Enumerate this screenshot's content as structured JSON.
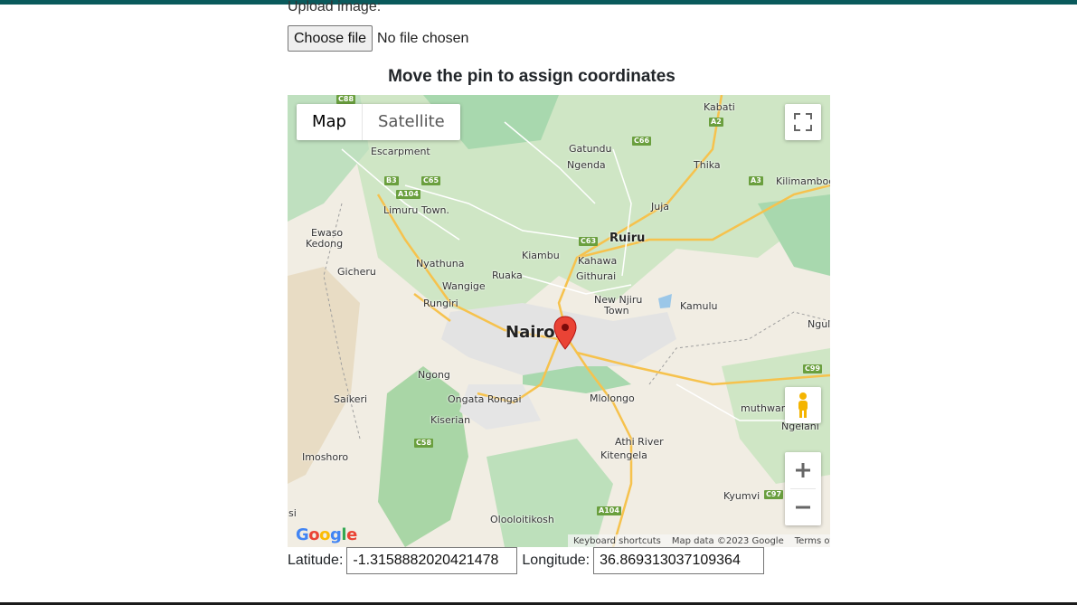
{
  "form": {
    "upload_label": "Upload image:",
    "choose_file_label": "Choose file",
    "file_status": "No file chosen",
    "map_heading": "Move the pin to assign coordinates"
  },
  "map": {
    "type_map": "Map",
    "type_satellite": "Satellite",
    "footer": {
      "shortcuts": "Keyboard shortcuts",
      "map_data": "Map data ©2023 Google",
      "terms": "Terms of Use"
    },
    "logo_text": "Google",
    "places": {
      "kabati": "Kabati",
      "gatundu": "Gatundu",
      "ngenda": "Ngenda",
      "thika": "Thika",
      "kilimambogo": "Kilimambog",
      "escarpment": "Escarpment",
      "limuru": "Limuru Town.",
      "juja": "Juja",
      "ewaso": "Ewaso\nKedong",
      "ruiru": "Ruiru",
      "kiambu": "Kiambu",
      "kahawa": "Kahawa",
      "nyathuna": "Nyathuna",
      "gicheru": "Gicheru",
      "ruaka": "Ruaka",
      "githurai": "Githurai",
      "wangige": "Wangige",
      "new_njiru": "New Njiru",
      "town": "Town",
      "kamulu": "Kamulu",
      "rungiri": "Rungiri",
      "nairobi": "Nairobi",
      "ngul": "Ngul",
      "ngong": "Ngong",
      "saikeri": "Saikeri",
      "ongata_rongai": "Ongata Rongai",
      "mlolongo": "Mlolongo",
      "muthwani": "muthwani",
      "ngelani": "Ngelani",
      "kiserian": "Kiserian",
      "athi_river": "Athi River",
      "kitengela": "Kitengela",
      "imoshoro": "Imoshoro",
      "kyumvi": "Kyumvi",
      "olooloitikosh": "Olooloitikosh",
      "si": "si"
    },
    "roads": [
      "C88",
      "A2",
      "C66",
      "B3",
      "C65",
      "A104",
      "A3",
      "C63",
      "C99",
      "C58",
      "C97",
      "A104"
    ]
  },
  "coords": {
    "lat_label": "Latitude:",
    "lat_value": "-1.3158882020421478",
    "lng_label": "Longitude:",
    "lng_value": "36.869313037109364"
  },
  "colors": {
    "top_bar": "#0a5a5c",
    "pin": "#ea4335"
  }
}
